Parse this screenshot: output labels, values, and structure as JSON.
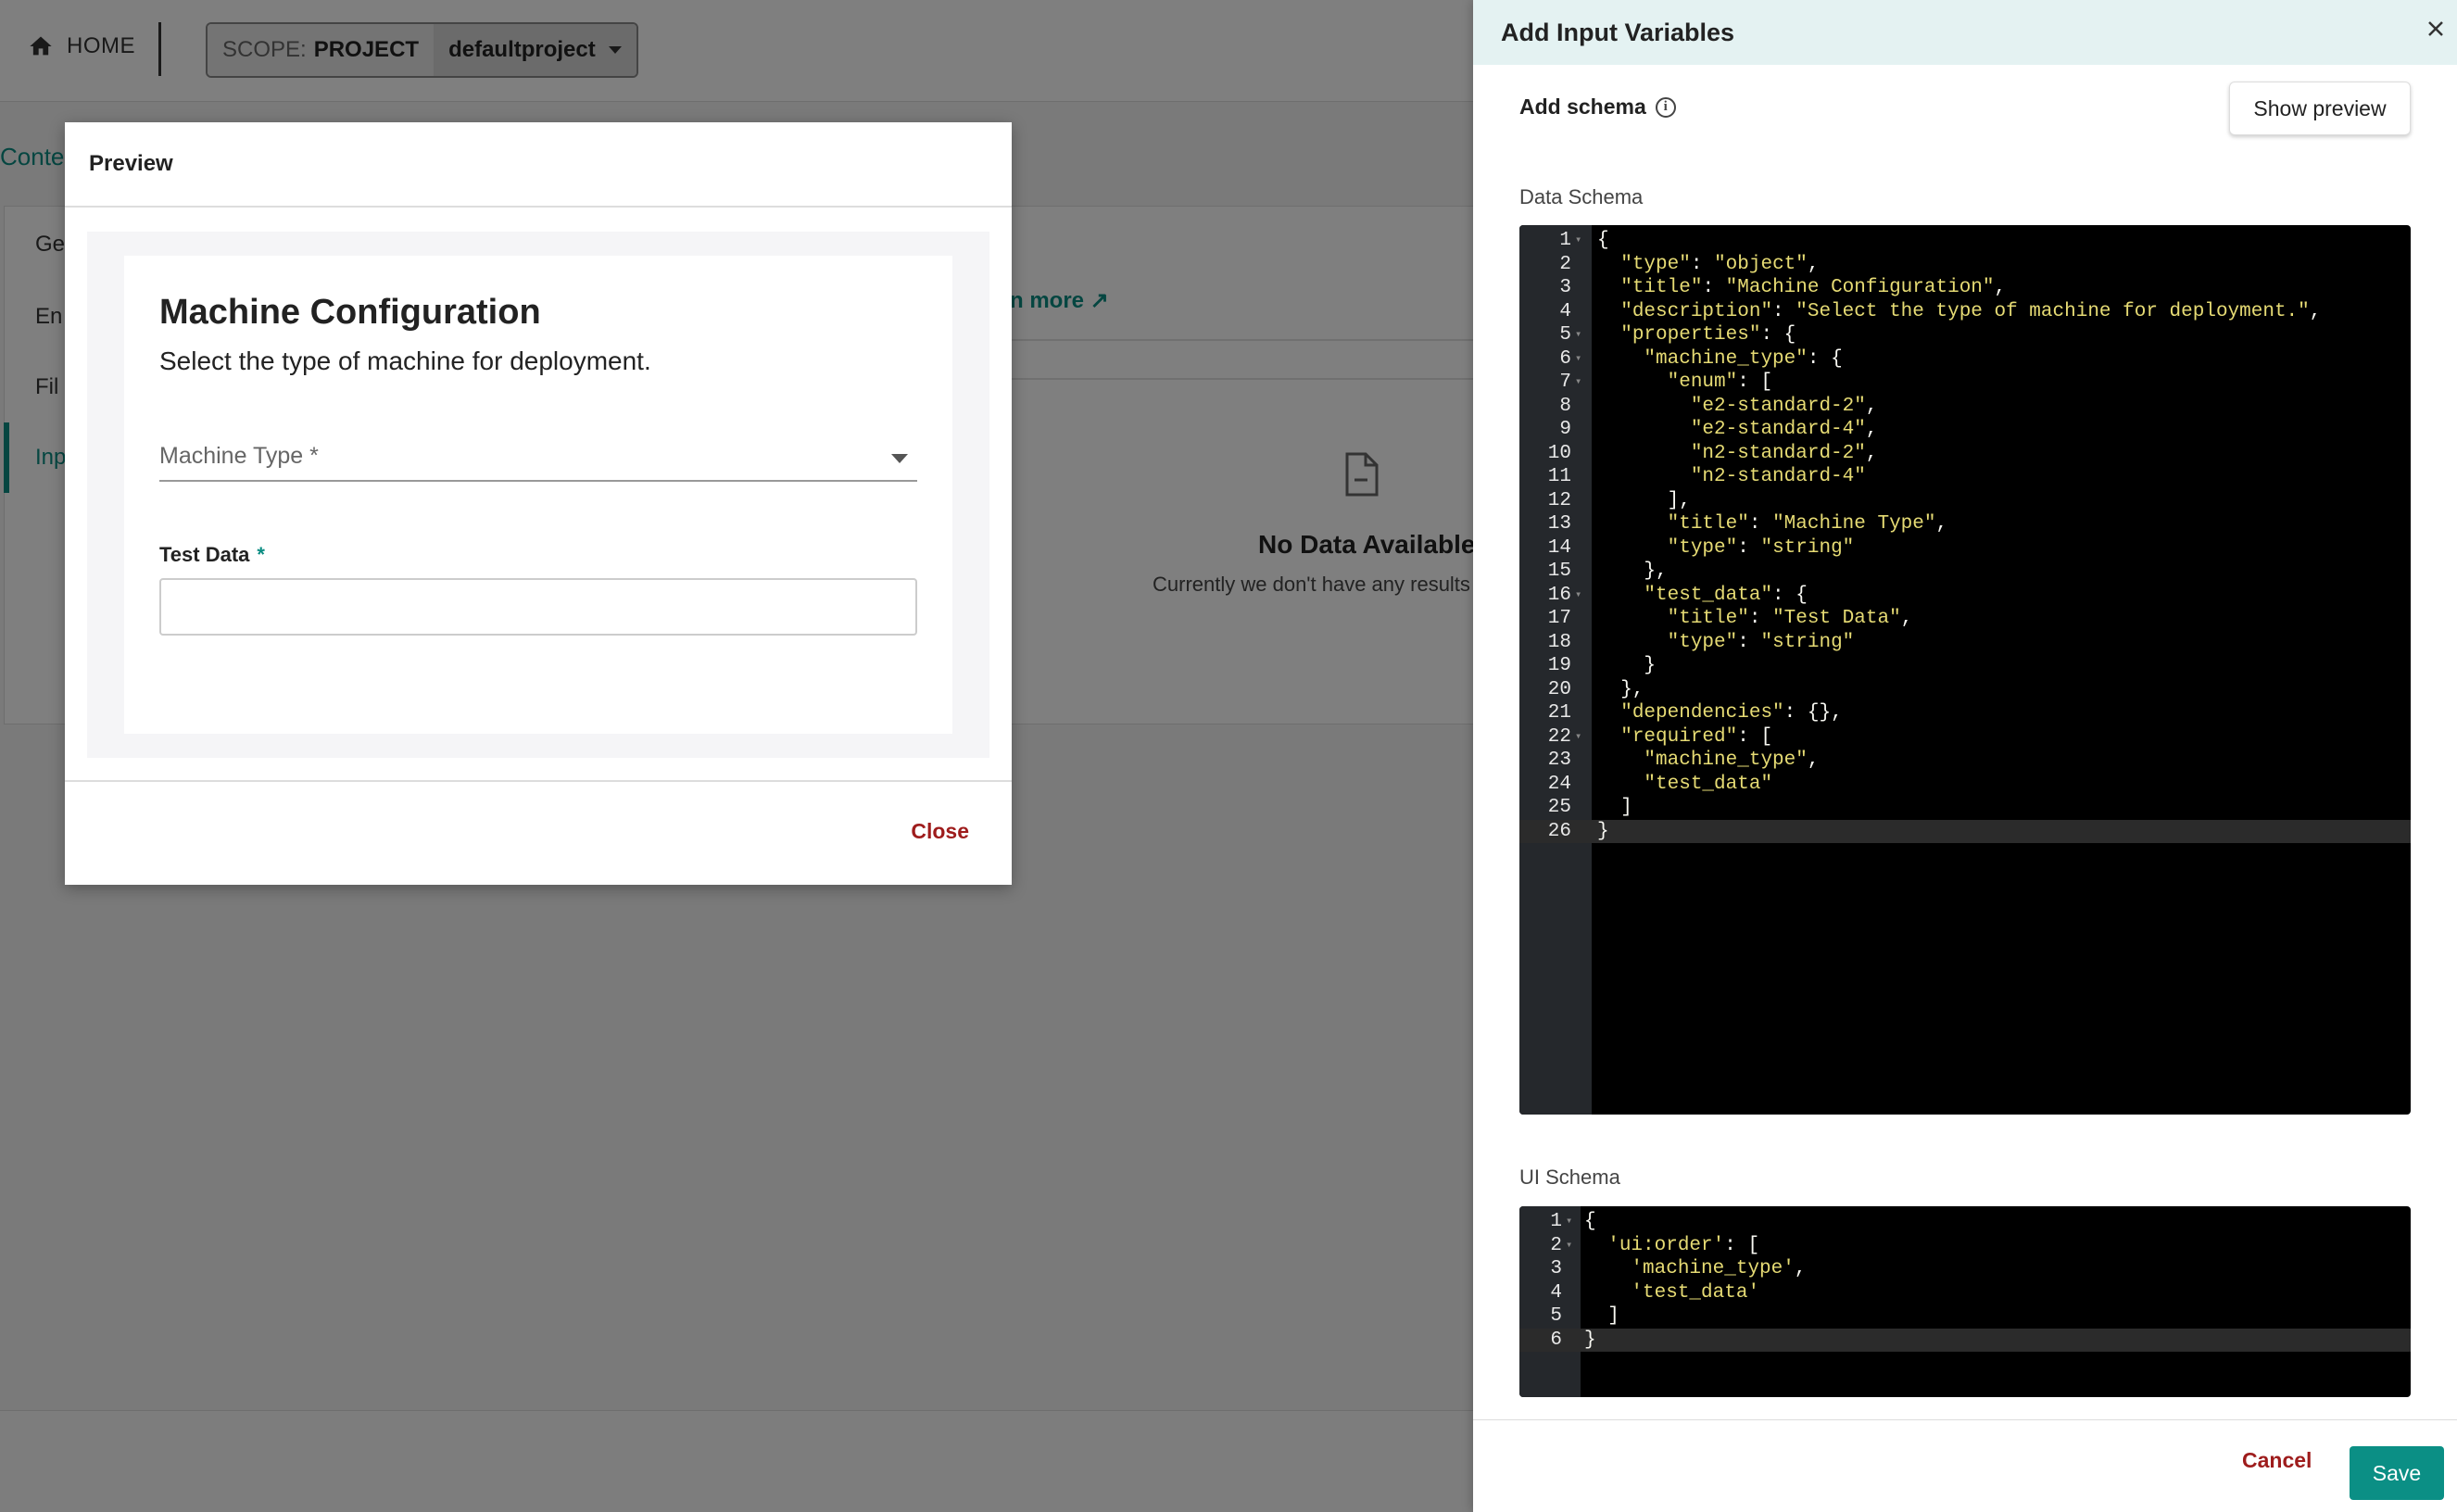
{
  "topbar": {
    "home_label": "HOME",
    "scope_prefix": "SCOPE:",
    "scope_level": "PROJECT",
    "project_name": "defaultproject"
  },
  "background": {
    "context_link": "Conte:",
    "side_items": [
      "Ge",
      "En",
      "Fil",
      "Inp"
    ],
    "learn_more": "n more ↗",
    "no_data_title": "No Data Available!",
    "no_data_subtitle": "Currently we don't have any results"
  },
  "preview_modal": {
    "title": "Preview",
    "form_title": "Machine Configuration",
    "form_description": "Select the type of machine for deployment.",
    "machine_type_label": "Machine Type *",
    "test_data_label": "Test Data",
    "test_data_required": "*",
    "close_label": "Close"
  },
  "drawer": {
    "title": "Add Input Variables",
    "add_schema_label": "Add schema",
    "show_preview_label": "Show preview",
    "data_schema_label": "Data Schema",
    "ui_schema_label": "UI Schema",
    "cancel_label": "Cancel",
    "save_label": "Save",
    "data_schema_lines": [
      "{",
      "  \"type\": \"object\",",
      "  \"title\": \"Machine Configuration\",",
      "  \"description\": \"Select the type of machine for deployment.\",",
      "  \"properties\": {",
      "    \"machine_type\": {",
      "      \"enum\": [",
      "        \"e2-standard-2\",",
      "        \"e2-standard-4\",",
      "        \"n2-standard-2\",",
      "        \"n2-standard-4\"",
      "      ],",
      "      \"title\": \"Machine Type\",",
      "      \"type\": \"string\"",
      "    },",
      "    \"test_data\": {",
      "      \"title\": \"Test Data\",",
      "      \"type\": \"string\"",
      "    }",
      "  },",
      "  \"dependencies\": {},",
      "  \"required\": [",
      "    \"machine_type\",",
      "    \"test_data\"",
      "  ]",
      "}"
    ],
    "data_schema_fold_lines": [
      1,
      5,
      6,
      7,
      16,
      22
    ],
    "ui_schema_lines": [
      "{",
      "  'ui:order': [",
      "    'machine_type',",
      "    'test_data'",
      "  ]",
      "}"
    ],
    "ui_schema_fold_lines": [
      1,
      2
    ]
  },
  "colors": {
    "accent": "#0b8f85",
    "danger": "#9e1c1c",
    "json_key": "#e6db74",
    "json_punct": "#f8f8f2",
    "editor_bg": "#000000"
  }
}
